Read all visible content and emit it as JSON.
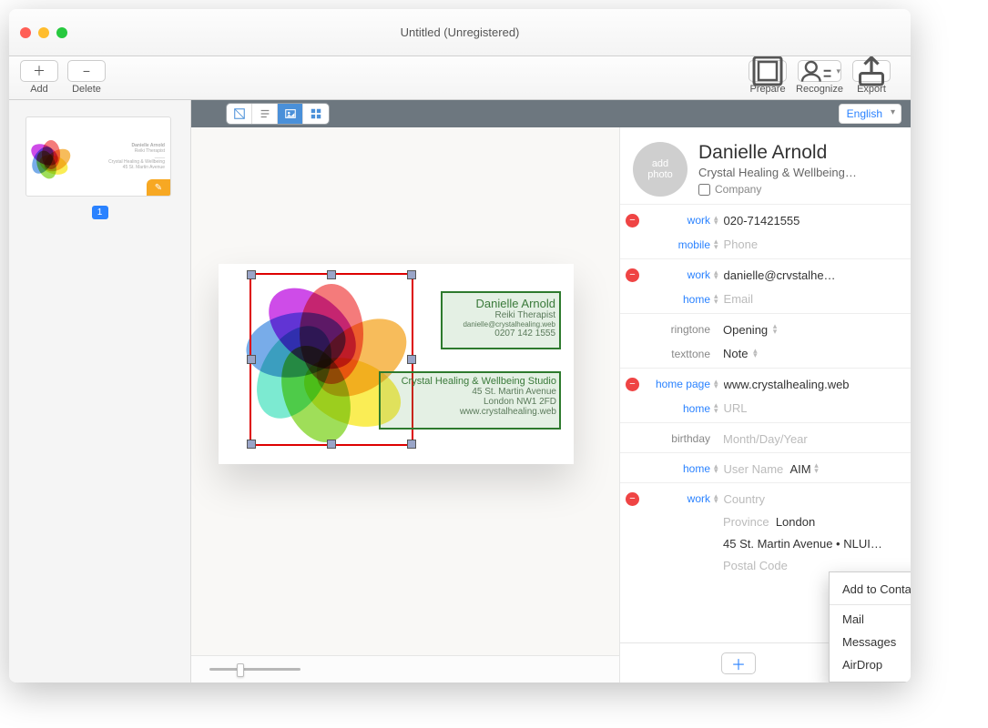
{
  "window": {
    "title": "Untitled (Unregistered)"
  },
  "toolbar": {
    "add": "Add",
    "delete": "Delete",
    "prepare": "Prepare",
    "recognize": "Recognize",
    "export": "Export"
  },
  "sidebar": {
    "page_number": "1"
  },
  "editor": {
    "language": "English"
  },
  "card": {
    "name": "Danielle Arnold",
    "role": "Reiki Therapist",
    "email_on_card": "danielle@crystalhealing.web",
    "phone_on_card": "0207 142 1555",
    "company_line": "Crystal Healing & Wellbeing Studio",
    "addr1": "45 St. Martin Avenue",
    "addr2": "London NW1 2FD",
    "web_on_card": "www.crystalhealing.web"
  },
  "contact": {
    "avatar_line1": "add",
    "avatar_line2": "photo",
    "name": "Danielle Arnold",
    "subtitle": "Crystal Healing & Wellbeing…",
    "company_label": "Company",
    "labels": {
      "work": "work",
      "mobile": "mobile",
      "home": "home",
      "ringtone": "ringtone",
      "texttone": "texttone",
      "homepage": "home page",
      "birthday": "birthday"
    },
    "values": {
      "work_phone": "020-71421555",
      "mobile_placeholder": "Phone",
      "work_email": "danielle@crvstalhe…",
      "home_email_placeholder": "Email",
      "ringtone": "Opening",
      "texttone": "Note",
      "homepage": "www.crystalhealing.web",
      "home_url_placeholder": "URL",
      "birthday_placeholder": "Month/Day/Year",
      "im_placeholder": "User Name",
      "im_service": "AIM",
      "addr_country_placeholder": "Country",
      "addr_province_placeholder": "Province",
      "addr_city": "London",
      "addr_street": "45 St. Martin Avenue  •  NLUI…",
      "addr_postal_placeholder": "Postal Code"
    }
  },
  "share_menu": {
    "add_contacts": "Add to Contacts",
    "mail": "Mail",
    "messages": "Messages",
    "airdrop": "AirDrop"
  }
}
